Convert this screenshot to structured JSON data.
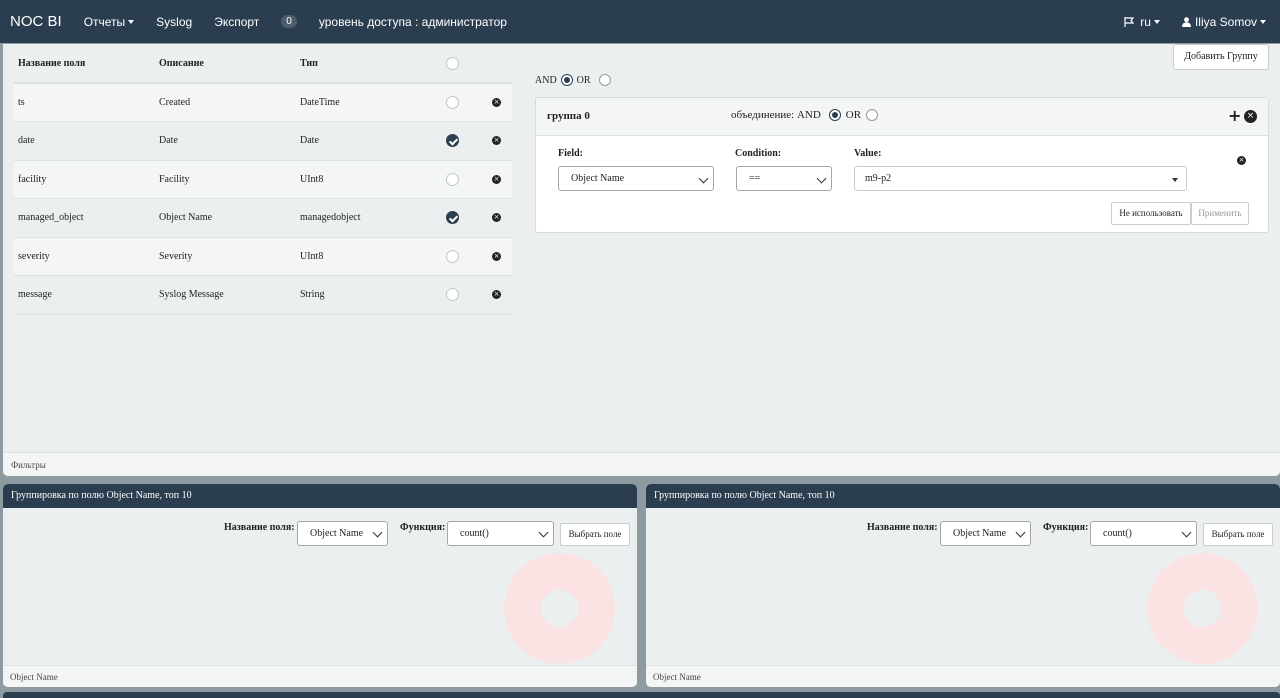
{
  "navbar": {
    "brand": "NOC BI",
    "reports": "Отчеты",
    "syslog": "Syslog",
    "export": "Экспорт",
    "badge": "0",
    "access": "уровень доступа : администратор",
    "lang": "ru",
    "user": "Iliya Somov"
  },
  "fields": {
    "headers": {
      "name": "Название поля",
      "desc": "Описание",
      "type": "Тип"
    },
    "rows": [
      {
        "name": "ts",
        "desc": "Created",
        "type": "DateTime",
        "checked": false
      },
      {
        "name": "date",
        "desc": "Date",
        "type": "Date",
        "checked": true
      },
      {
        "name": "facility",
        "desc": "Facility",
        "type": "UInt8",
        "checked": false
      },
      {
        "name": "managed_object",
        "desc": "Object Name",
        "type": "managedobject",
        "checked": true
      },
      {
        "name": "severity",
        "desc": "Severity",
        "type": "UInt8",
        "checked": false
      },
      {
        "name": "message",
        "desc": "Syslog Message",
        "type": "String",
        "checked": false
      }
    ]
  },
  "filters": {
    "add_group": "Добавить Группу",
    "and": "AND",
    "or": "OR",
    "group": {
      "title": "группа 0",
      "join_label": "объединение: AND",
      "or": "OR",
      "field_label": "Field:",
      "condition_label": "Condition:",
      "value_label": "Value:",
      "field_value": "Object Name",
      "condition_value": "==",
      "value_value": "m9-p2",
      "ignore_button": "Не использовать",
      "apply_button": "Применить"
    },
    "footer": "Фильтры"
  },
  "panels": [
    {
      "title": "Группировка по полю Object Name, топ 10",
      "field_label": "Название поля:",
      "field_value": "Object Name",
      "func_label": "Функция:",
      "func_value": "count()",
      "select_button": "Выбрать поле",
      "footer": "Object Name"
    },
    {
      "title": "Группировка по полю Object Name, топ 10",
      "field_label": "Название поля:",
      "field_value": "Object Name",
      "func_label": "Функция:",
      "func_value": "count()",
      "select_button": "Выбрать поле",
      "footer": "Object Name"
    }
  ]
}
